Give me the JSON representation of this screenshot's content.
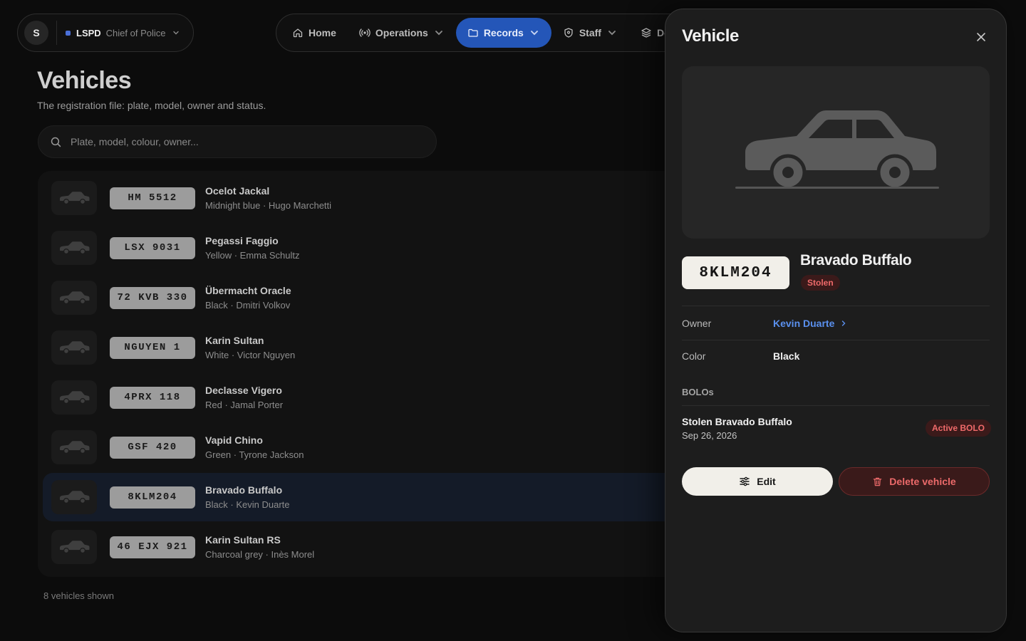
{
  "org": {
    "avatar_letter": "S",
    "name": "LSPD",
    "role": "Chief of Police"
  },
  "nav": {
    "items": [
      {
        "label": "Home",
        "icon": "home-icon",
        "active": false
      },
      {
        "label": "Operations",
        "icon": "broadcast-icon",
        "active": false
      },
      {
        "label": "Records",
        "icon": "folder-icon",
        "active": true
      },
      {
        "label": "Staff",
        "icon": "shield-icon",
        "active": false
      },
      {
        "label": "De",
        "icon": "layers-icon",
        "active": false
      }
    ]
  },
  "page": {
    "title": "Vehicles",
    "subtitle": "The registration file: plate, model, owner and status.",
    "search_placeholder": "Plate, model, colour, owner...",
    "count_label": "8 vehicles shown"
  },
  "vehicles": [
    {
      "plate": "HM 5512",
      "model": "Ocelot Jackal",
      "meta": "Midnight blue · Hugo Marchetti"
    },
    {
      "plate": "LSX 9031",
      "model": "Pegassi Faggio",
      "meta": "Yellow · Emma Schultz"
    },
    {
      "plate": "72 KVB 330",
      "model": "Übermacht Oracle",
      "meta": "Black · Dmitri Volkov"
    },
    {
      "plate": "NGUYEN 1",
      "model": "Karin Sultan",
      "meta": "White · Victor Nguyen"
    },
    {
      "plate": "4PRX 118",
      "model": "Declasse Vigero",
      "meta": "Red · Jamal Porter"
    },
    {
      "plate": "GSF 420",
      "model": "Vapid Chino",
      "meta": "Green · Tyrone Jackson"
    },
    {
      "plate": "8KLM204",
      "model": "Bravado Buffalo",
      "meta": "Black · Kevin Duarte",
      "selected": true
    },
    {
      "plate": "46 EJX 921",
      "model": "Karin Sultan RS",
      "meta": "Charcoal grey · Inès Morel"
    }
  ],
  "drawer": {
    "title": "Vehicle",
    "plate": "8KLM204",
    "model": "Bravado Buffalo",
    "status": "Stolen",
    "owner_label": "Owner",
    "owner_value": "Kevin Duarte",
    "color_label": "Color",
    "color_value": "Black",
    "bolos_label": "BOLOs",
    "bolo": {
      "title": "Stolen Bravado Buffalo",
      "date": "Sep 26, 2026",
      "status": "Active BOLO"
    },
    "edit_label": "Edit",
    "delete_label": "Delete vehicle"
  },
  "colors": {
    "accent": "#2456b8",
    "link": "#5a90ee",
    "danger": "#ef6a6a",
    "danger_bg": "#3b1a1a"
  }
}
